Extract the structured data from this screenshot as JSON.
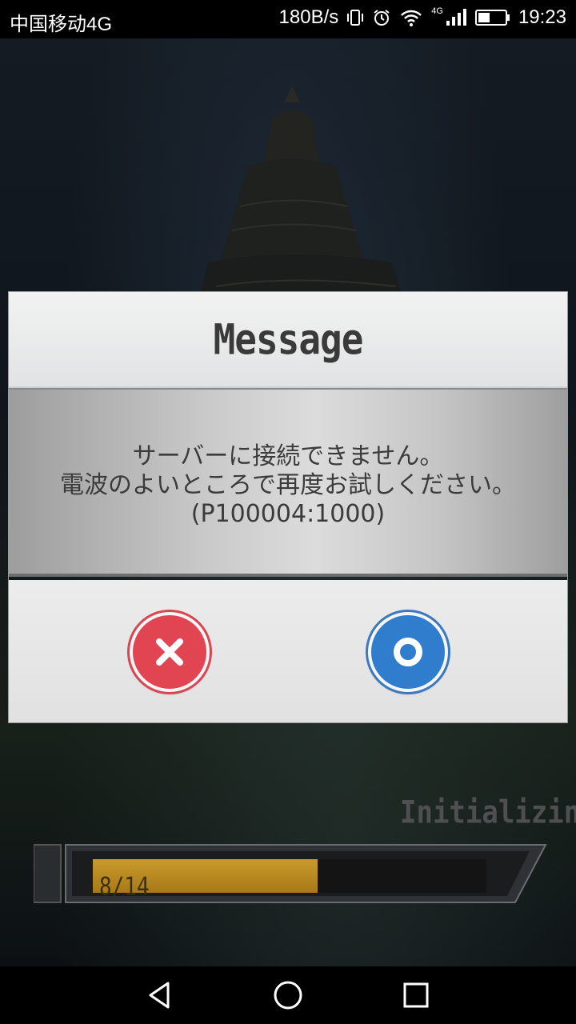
{
  "status_bar": {
    "carrier": "中国移动4G",
    "speed": "180B/s",
    "network_small": "4G",
    "time": "19:23"
  },
  "dialog": {
    "title": "Message",
    "message_lines": [
      "サーバーに接続できません。",
      "電波のよいところで再度お試しください。",
      "(P100004:1000)"
    ],
    "cancel_icon": "close-icon",
    "ok_icon": "circle-icon"
  },
  "loading": {
    "label": "Initializing",
    "progress_text": "8/14",
    "current": 8,
    "total": 14
  },
  "colors": {
    "cancel": "#e14552",
    "ok": "#2f7dcc",
    "progress": "#c99a2b"
  }
}
